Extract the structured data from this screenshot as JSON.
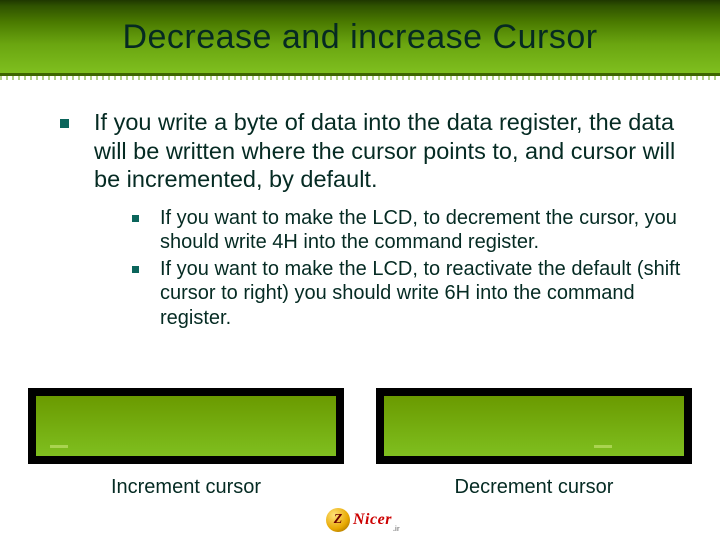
{
  "title": "Decrease and increase Cursor",
  "bullet1": "If you write a byte of data into the data register, the data will be written where the cursor points to, and cursor will be incremented, by default.",
  "subbullet1": "If you want to make the LCD, to decrement the cursor, you should write 4H into the command register.",
  "subbullet2": "If you want to make the LCD, to reactivate the default (shift cursor to right) you should write 6H into the command register.",
  "caption_left": "Increment cursor",
  "caption_right": "Decrement cursor",
  "logo": {
    "brand": "Nicer",
    "sub": ".ir"
  }
}
